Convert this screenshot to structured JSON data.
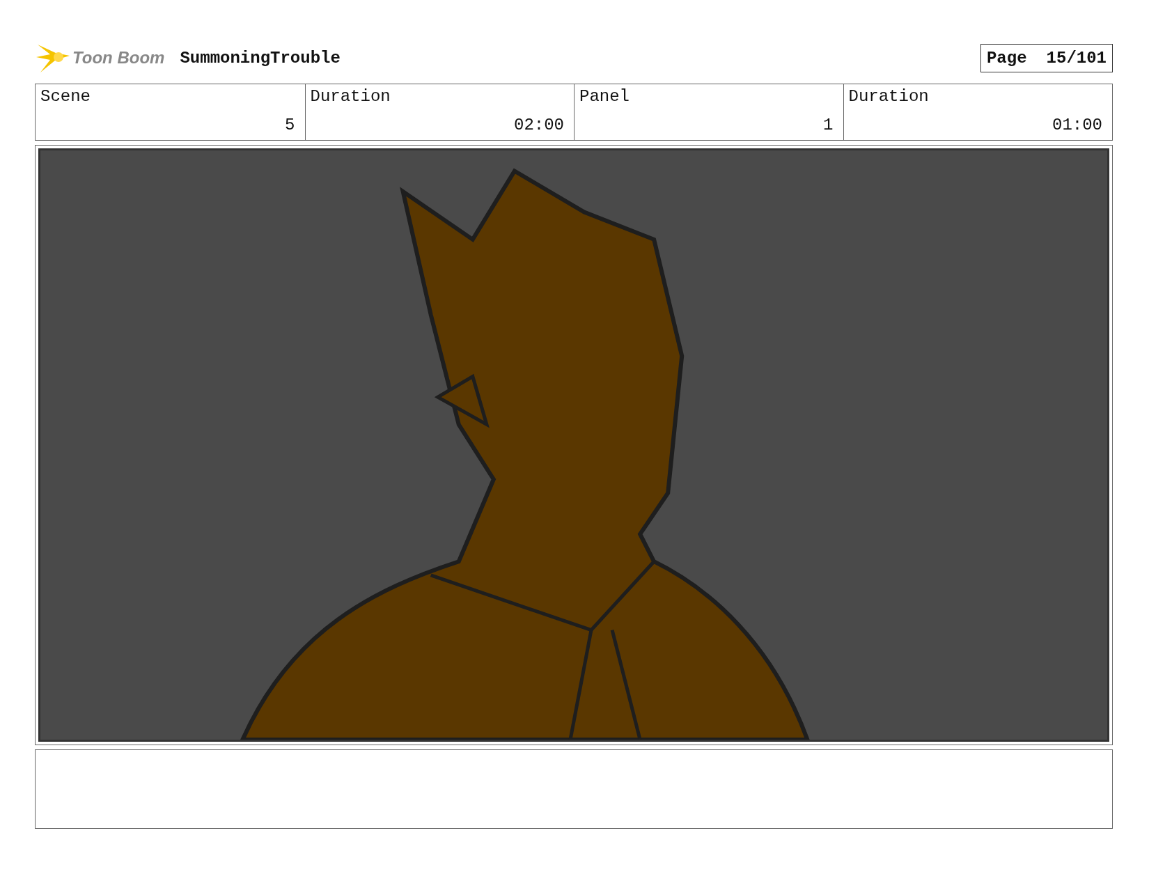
{
  "header": {
    "logo_text": "Toon Boom",
    "project_title": "SummoningTrouble",
    "page_label": "Page",
    "page_number": "15/101"
  },
  "info_cells": [
    {
      "label": "Scene",
      "value": "5"
    },
    {
      "label": "Duration",
      "value": "02:00"
    },
    {
      "label": "Panel",
      "value": "1"
    },
    {
      "label": "Duration",
      "value": "01:00"
    }
  ]
}
